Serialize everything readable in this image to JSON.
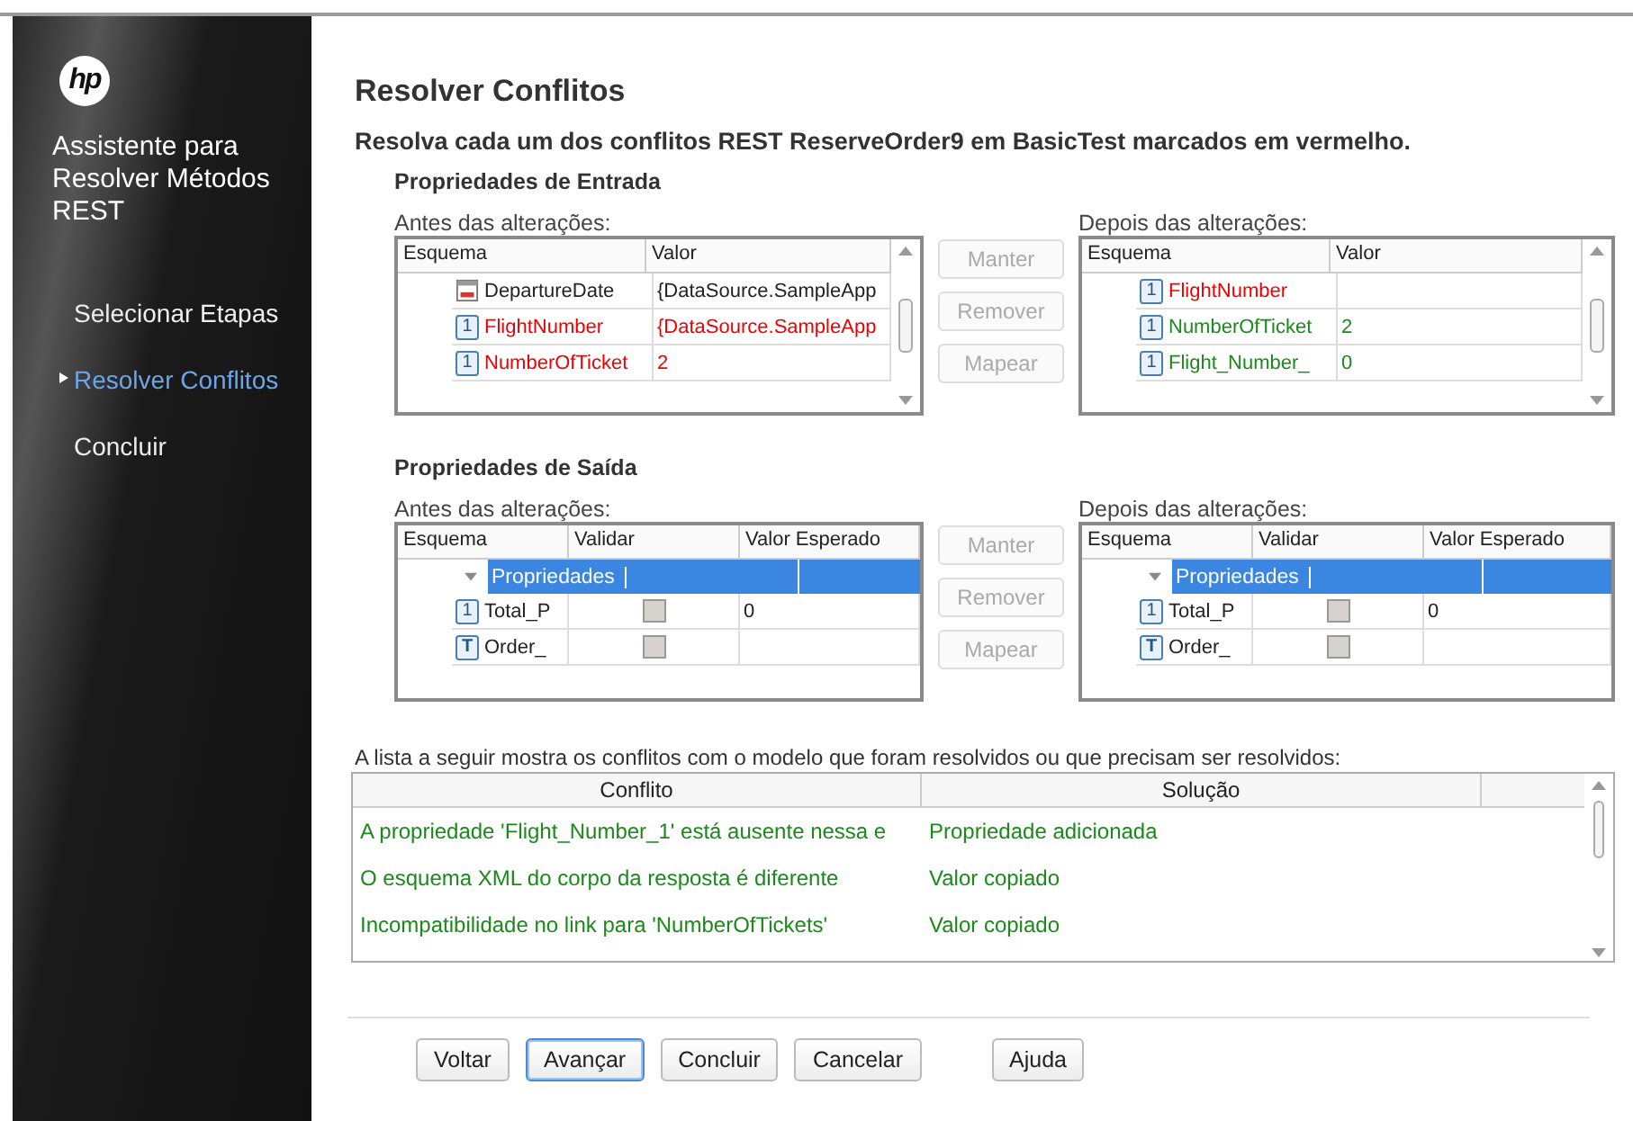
{
  "sidebar": {
    "logo": "hp",
    "title": "Assistente para Resolver Métodos REST",
    "steps": [
      {
        "label": "Selecionar Etapas",
        "selected": false
      },
      {
        "label": "Resolver Conflitos",
        "selected": true
      },
      {
        "label": "Concluir",
        "selected": false
      }
    ]
  },
  "heading": "Resolver Conflitos",
  "subheading": "Resolva cada um dos conflitos REST ReserveOrder9 em BasicTest marcados em vermelho.",
  "input_section": {
    "title": "Propriedades de Entrada",
    "before": {
      "label": "Antes das alterações:",
      "columns": [
        "Esquema",
        "Valor"
      ],
      "rows": [
        {
          "kind": "date",
          "name": "DepartureDate",
          "value": "{DataSource.SampleApp",
          "color": "#222222"
        },
        {
          "kind": "number",
          "badge": "1",
          "name": "FlightNumber",
          "value": "{DataSource.SampleApp",
          "color": "#ee0000"
        },
        {
          "kind": "number",
          "badge": "1",
          "name": "NumberOfTicket",
          "value": "2",
          "color": "#ee0000"
        }
      ]
    },
    "actions": [
      {
        "label": "Manter",
        "disabled": true
      },
      {
        "label": "Remover",
        "disabled": true
      },
      {
        "label": "Mapear",
        "disabled": true
      }
    ],
    "after": {
      "label": "Depois das alterações:",
      "columns": [
        "Esquema",
        "Valor"
      ],
      "rows": [
        {
          "kind": "number",
          "badge": "1",
          "name": "FlightNumber",
          "value": "",
          "color": "#ee0000"
        },
        {
          "kind": "number",
          "badge": "1",
          "name": "NumberOfTicket",
          "value": "2",
          "color": "#1a8a1a"
        },
        {
          "kind": "number",
          "badge": "1",
          "name": "Flight_Number_",
          "value": "0",
          "color": "#1a8a1a"
        }
      ]
    }
  },
  "output_section": {
    "title": "Propriedades de Saída",
    "before": {
      "label": "Antes das alterações:",
      "columns": [
        "Esquema",
        "Validar",
        "Valor Esperado"
      ],
      "group": {
        "name": "Propriedades",
        "expanded": true,
        "selected": true
      },
      "rows": [
        {
          "kind": "number",
          "badge": "1",
          "name": "Total_P",
          "checked": false,
          "disabled": true,
          "expected": "0"
        },
        {
          "kind": "text",
          "badge": "T",
          "name": "Order_",
          "checked": false,
          "disabled": true,
          "expected": ""
        }
      ]
    },
    "actions": [
      {
        "label": "Manter",
        "disabled": true
      },
      {
        "label": "Remover",
        "disabled": true
      },
      {
        "label": "Mapear",
        "disabled": true
      }
    ],
    "after": {
      "label": "Depois das alterações:",
      "columns": [
        "Esquema",
        "Validar",
        "Valor Esperado"
      ],
      "group": {
        "name": "Propriedades",
        "expanded": true,
        "selected": true
      },
      "rows": [
        {
          "kind": "number",
          "badge": "1",
          "name": "Total_P",
          "checked": false,
          "disabled": true,
          "expected": "0"
        },
        {
          "kind": "text",
          "badge": "T",
          "name": "Order_",
          "checked": false,
          "disabled": true,
          "expected": ""
        }
      ]
    }
  },
  "conflicts": {
    "caption": "A lista a seguir mostra os conflitos com o modelo que foram resolvidos ou que precisam ser resolvidos:",
    "columns": [
      "Conflito",
      "Solução"
    ],
    "rows": [
      {
        "conflict": "A propriedade 'Flight_Number_1' está ausente nessa e",
        "solution": "Propriedade adicionada",
        "color": "#1a8a1a"
      },
      {
        "conflict": "O esquema XML do corpo da resposta é diferente",
        "solution": "Valor copiado",
        "color": "#1a8a1a"
      },
      {
        "conflict": "Incompatibilidade no link para 'NumberOfTickets'",
        "solution": "Valor copiado",
        "color": "#1a8a1a"
      }
    ]
  },
  "buttons": [
    {
      "label": "Voltar",
      "default": false
    },
    {
      "label": "Avançar",
      "default": true
    },
    {
      "label": "Concluir",
      "default": false
    },
    {
      "label": "Cancelar",
      "default": false
    },
    {
      "label": "Ajuda",
      "default": false
    }
  ]
}
